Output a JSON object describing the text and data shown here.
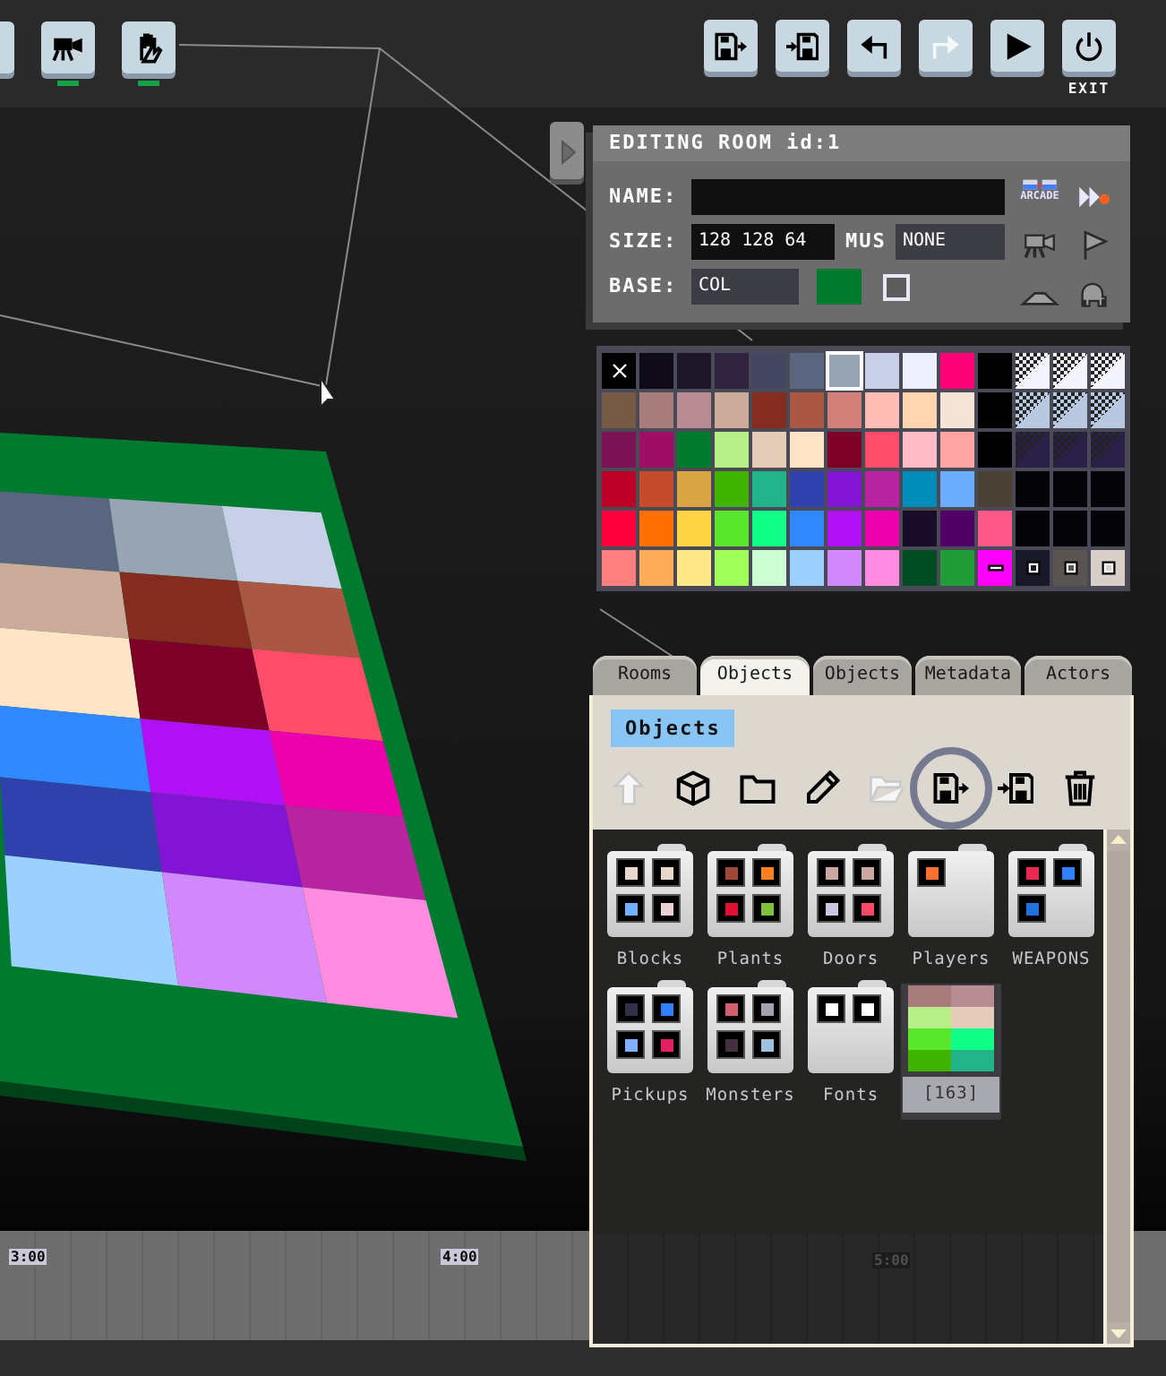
{
  "toolbar_left": [
    {
      "kind": "blank"
    },
    {
      "kind": "camera",
      "active": true
    },
    {
      "kind": "hand",
      "active": true
    }
  ],
  "toolbar_right": [
    {
      "kind": "save-out",
      "disabled": false
    },
    {
      "kind": "save-in",
      "disabled": false
    },
    {
      "kind": "undo",
      "disabled": false
    },
    {
      "kind": "redo",
      "disabled": true
    },
    {
      "kind": "play",
      "disabled": false
    },
    {
      "kind": "power",
      "disabled": false,
      "label": "EXIT"
    }
  ],
  "room_panel": {
    "title": "EDITING ROOM id:1",
    "name": {
      "label": "NAME:"
    },
    "size": {
      "label": "SIZE:",
      "value": "128 128 64"
    },
    "music": {
      "label": "MUS",
      "value": "NONE"
    },
    "base": {
      "label": "BASE:",
      "value": "COL",
      "color": "#007a2e",
      "checked": false
    },
    "side_tools": [
      {
        "kind": "arcade",
        "label": "ARCADE"
      },
      {
        "kind": "fast-forward"
      },
      {
        "kind": "camera"
      },
      {
        "kind": "flag"
      },
      {
        "kind": "hill"
      },
      {
        "kind": "elephant"
      }
    ]
  },
  "palette": {
    "cells": [
      {
        "kind": "clear",
        "color": "#000000",
        "selected": false
      },
      {
        "kind": "swatch",
        "color": "#0e0a18",
        "selected": false
      },
      {
        "kind": "swatch",
        "color": "#1c1628",
        "selected": false
      },
      {
        "kind": "swatch",
        "color": "#2e2440",
        "selected": false
      },
      {
        "kind": "swatch",
        "color": "#424660",
        "selected": false
      },
      {
        "kind": "swatch",
        "color": "#5a6680",
        "selected": false
      },
      {
        "kind": "swatch",
        "color": "#98a4b4",
        "selected": true
      },
      {
        "kind": "swatch",
        "color": "#c8d0e8",
        "selected": false
      },
      {
        "kind": "swatch",
        "color": "#eeeeff",
        "selected": false
      },
      {
        "kind": "swatch",
        "color": "#ff0077",
        "selected": false
      },
      {
        "kind": "swatch",
        "color": "#000000",
        "selected": false
      },
      {
        "kind": "pattern",
        "color": "#f4f4ff",
        "selected": false
      },
      {
        "kind": "pattern",
        "color": "#f4f4ff",
        "selected": false
      },
      {
        "kind": "pattern",
        "color": "#f4f4ff",
        "selected": false
      },
      {
        "kind": "swatch",
        "color": "#765a46",
        "selected": false
      },
      {
        "kind": "swatch",
        "color": "#a87c7c",
        "selected": false
      },
      {
        "kind": "swatch",
        "color": "#b88c94",
        "selected": false
      },
      {
        "kind": "swatch",
        "color": "#ccaa9c",
        "selected": false
      },
      {
        "kind": "swatch",
        "color": "#842c20",
        "selected": false
      },
      {
        "kind": "swatch",
        "color": "#aa5844",
        "selected": false
      },
      {
        "kind": "swatch",
        "color": "#d4807a",
        "selected": false
      },
      {
        "kind": "swatch",
        "color": "#ffbcb4",
        "selected": false
      },
      {
        "kind": "swatch",
        "color": "#ffd4b0",
        "selected": false
      },
      {
        "kind": "swatch",
        "color": "#f4e4d8",
        "selected": false
      },
      {
        "kind": "swatch",
        "color": "#000000",
        "selected": false
      },
      {
        "kind": "pattern",
        "color": "#b8c8e0",
        "selected": false
      },
      {
        "kind": "pattern",
        "color": "#b8c8e0",
        "selected": false
      },
      {
        "kind": "pattern",
        "color": "#b8c8e0",
        "selected": false
      },
      {
        "kind": "swatch",
        "color": "#7a1254",
        "selected": false
      },
      {
        "kind": "swatch",
        "color": "#9e0e64",
        "selected": false
      },
      {
        "kind": "swatch",
        "color": "#007a2e",
        "selected": false
      },
      {
        "kind": "swatch",
        "color": "#b8ee88",
        "selected": false
      },
      {
        "kind": "swatch",
        "color": "#e4ccb8",
        "selected": false
      },
      {
        "kind": "swatch",
        "color": "#ffe4c8",
        "selected": false
      },
      {
        "kind": "swatch",
        "color": "#7c0028",
        "selected": false
      },
      {
        "kind": "swatch",
        "color": "#ff4c6a",
        "selected": false
      },
      {
        "kind": "swatch",
        "color": "#ffbcc8",
        "selected": false
      },
      {
        "kind": "swatch",
        "color": "#ffa4a4",
        "selected": false
      },
      {
        "kind": "swatch",
        "color": "#000000",
        "selected": false
      },
      {
        "kind": "pattern",
        "color": "#2a2048",
        "selected": false
      },
      {
        "kind": "pattern",
        "color": "#2a2048",
        "selected": false
      },
      {
        "kind": "pattern",
        "color": "#2a2048",
        "selected": false
      },
      {
        "kind": "swatch",
        "color": "#bc0028",
        "selected": false
      },
      {
        "kind": "swatch",
        "color": "#c44c2c",
        "selected": false
      },
      {
        "kind": "swatch",
        "color": "#d8a444",
        "selected": false
      },
      {
        "kind": "swatch",
        "color": "#40b400",
        "selected": false
      },
      {
        "kind": "swatch",
        "color": "#22b488",
        "selected": false
      },
      {
        "kind": "swatch",
        "color": "#3040ac",
        "selected": false
      },
      {
        "kind": "swatch",
        "color": "#8414d4",
        "selected": false
      },
      {
        "kind": "swatch",
        "color": "#b824a0",
        "selected": false
      },
      {
        "kind": "swatch",
        "color": "#008cb8",
        "selected": false
      },
      {
        "kind": "swatch",
        "color": "#6cacff",
        "selected": false
      },
      {
        "kind": "swatch",
        "color": "#4a4034",
        "selected": false
      },
      {
        "kind": "swatch",
        "color": "#040408",
        "selected": false
      },
      {
        "kind": "swatch",
        "color": "#040408",
        "selected": false
      },
      {
        "kind": "swatch",
        "color": "#040408",
        "selected": false
      },
      {
        "kind": "swatch",
        "color": "#ff003c",
        "selected": false
      },
      {
        "kind": "swatch",
        "color": "#ff7000",
        "selected": false
      },
      {
        "kind": "swatch",
        "color": "#ffd444",
        "selected": false
      },
      {
        "kind": "swatch",
        "color": "#5ae62c",
        "selected": false
      },
      {
        "kind": "swatch",
        "color": "#10ff88",
        "selected": false
      },
      {
        "kind": "swatch",
        "color": "#3288ff",
        "selected": false
      },
      {
        "kind": "swatch",
        "color": "#b010f4",
        "selected": false
      },
      {
        "kind": "swatch",
        "color": "#ec00ac",
        "selected": false
      },
      {
        "kind": "swatch",
        "color": "#180e28",
        "selected": false
      },
      {
        "kind": "swatch",
        "color": "#500064",
        "selected": false
      },
      {
        "kind": "swatch",
        "color": "#ff5888",
        "selected": false
      },
      {
        "kind": "swatch",
        "color": "#040408",
        "selected": false
      },
      {
        "kind": "swatch",
        "color": "#040408",
        "selected": false
      },
      {
        "kind": "swatch",
        "color": "#040408",
        "selected": false
      },
      {
        "kind": "swatch",
        "color": "#ff8080",
        "selected": false
      },
      {
        "kind": "swatch",
        "color": "#ffac5a",
        "selected": false
      },
      {
        "kind": "swatch",
        "color": "#ffe888",
        "selected": false
      },
      {
        "kind": "swatch",
        "color": "#a0ff58",
        "selected": false
      },
      {
        "kind": "swatch",
        "color": "#ccffd4",
        "selected": false
      },
      {
        "kind": "swatch",
        "color": "#9cd0ff",
        "selected": false
      },
      {
        "kind": "swatch",
        "color": "#d088fa",
        "selected": false
      },
      {
        "kind": "swatch",
        "color": "#ff8ce0",
        "selected": false
      },
      {
        "kind": "swatch",
        "color": "#004c24",
        "selected": false
      },
      {
        "kind": "swatch",
        "color": "#229c38",
        "selected": false
      },
      {
        "kind": "dash",
        "color": "#ff00ff",
        "selected": false
      },
      {
        "kind": "square",
        "color": "#181828",
        "selected": false
      },
      {
        "kind": "square",
        "color": "#5a5450",
        "selected": false
      },
      {
        "kind": "square",
        "color": "#d8d0c8",
        "selected": false
      }
    ]
  },
  "tabs": [
    {
      "label": "Rooms",
      "selected": false
    },
    {
      "label": "Objects",
      "selected": true
    },
    {
      "label": "Objects",
      "selected": false
    },
    {
      "label": "Metadata",
      "selected": false
    },
    {
      "label": "Actors",
      "selected": false
    }
  ],
  "objects_panel": {
    "heading": "Objects",
    "tools": [
      {
        "kind": "up",
        "disabled": true,
        "highlighted": false
      },
      {
        "kind": "cube",
        "disabled": false,
        "highlighted": false
      },
      {
        "kind": "folder",
        "disabled": false,
        "highlighted": false
      },
      {
        "kind": "pencil",
        "disabled": false,
        "highlighted": false
      },
      {
        "kind": "open-folder",
        "disabled": true,
        "highlighted": false
      },
      {
        "kind": "save-out",
        "disabled": false,
        "highlighted": true
      },
      {
        "kind": "save-in",
        "disabled": false,
        "highlighted": false
      },
      {
        "kind": "trash",
        "disabled": false,
        "highlighted": false
      }
    ],
    "items": [
      {
        "kind": "folder",
        "label": "Blocks",
        "selected": false,
        "sprites": [
          {
            "color": "#e8d8cc"
          },
          {
            "color": "#e8d8cc"
          },
          {
            "color": "#70b0ff"
          },
          {
            "color": "#e8d0d4"
          }
        ]
      },
      {
        "kind": "folder",
        "label": "Plants",
        "selected": false,
        "sprites": [
          {
            "color": "#a04838"
          },
          {
            "color": "#ff8020"
          },
          {
            "color": "#e01030"
          },
          {
            "color": "#80c040"
          }
        ]
      },
      {
        "kind": "folder",
        "label": "Doors",
        "selected": false,
        "sprites": [
          {
            "color": "#c8a8a0"
          },
          {
            "color": "#c8a8a0"
          },
          {
            "color": "#c8c8e0"
          },
          {
            "color": "#ff4868"
          }
        ]
      },
      {
        "kind": "folder",
        "label": "Players",
        "selected": false,
        "sprites": [
          {
            "color": "#ff7030"
          }
        ]
      },
      {
        "kind": "folder",
        "label": "WEAPONS",
        "selected": false,
        "sprites": [
          {
            "color": "#e82850"
          },
          {
            "color": "#3080ff"
          },
          {
            "color": "#2070e0"
          }
        ]
      },
      {
        "kind": "folder",
        "label": "Pickups",
        "selected": false,
        "sprites": [
          {
            "color": "#303048"
          },
          {
            "color": "#3080ff"
          },
          {
            "color": "#80b0ff"
          },
          {
            "color": "#e02060"
          }
        ]
      },
      {
        "kind": "folder",
        "label": "Monsters",
        "selected": false,
        "sprites": [
          {
            "color": "#d06070"
          },
          {
            "color": "#a8a0b0"
          },
          {
            "color": "#403040"
          },
          {
            "color": "#a0c0e0"
          }
        ]
      },
      {
        "kind": "folder",
        "label": "Fonts",
        "selected": false,
        "sprites": [
          {
            "color": "#ffffff"
          },
          {
            "color": "#ffffff"
          }
        ]
      },
      {
        "kind": "palette",
        "label": "[163]",
        "selected": true,
        "sprites": [
          {
            "color": "#a87c7c"
          },
          {
            "color": "#b88c94"
          },
          {
            "color": "#b8ee88"
          },
          {
            "color": "#e4ccb8"
          },
          {
            "color": "#5ae62c"
          },
          {
            "color": "#10ff88"
          },
          {
            "color": "#40b400"
          },
          {
            "color": "#22b488"
          }
        ]
      }
    ]
  },
  "timeline": {
    "marks": [
      "3:00",
      "4:00",
      "5:00"
    ]
  }
}
